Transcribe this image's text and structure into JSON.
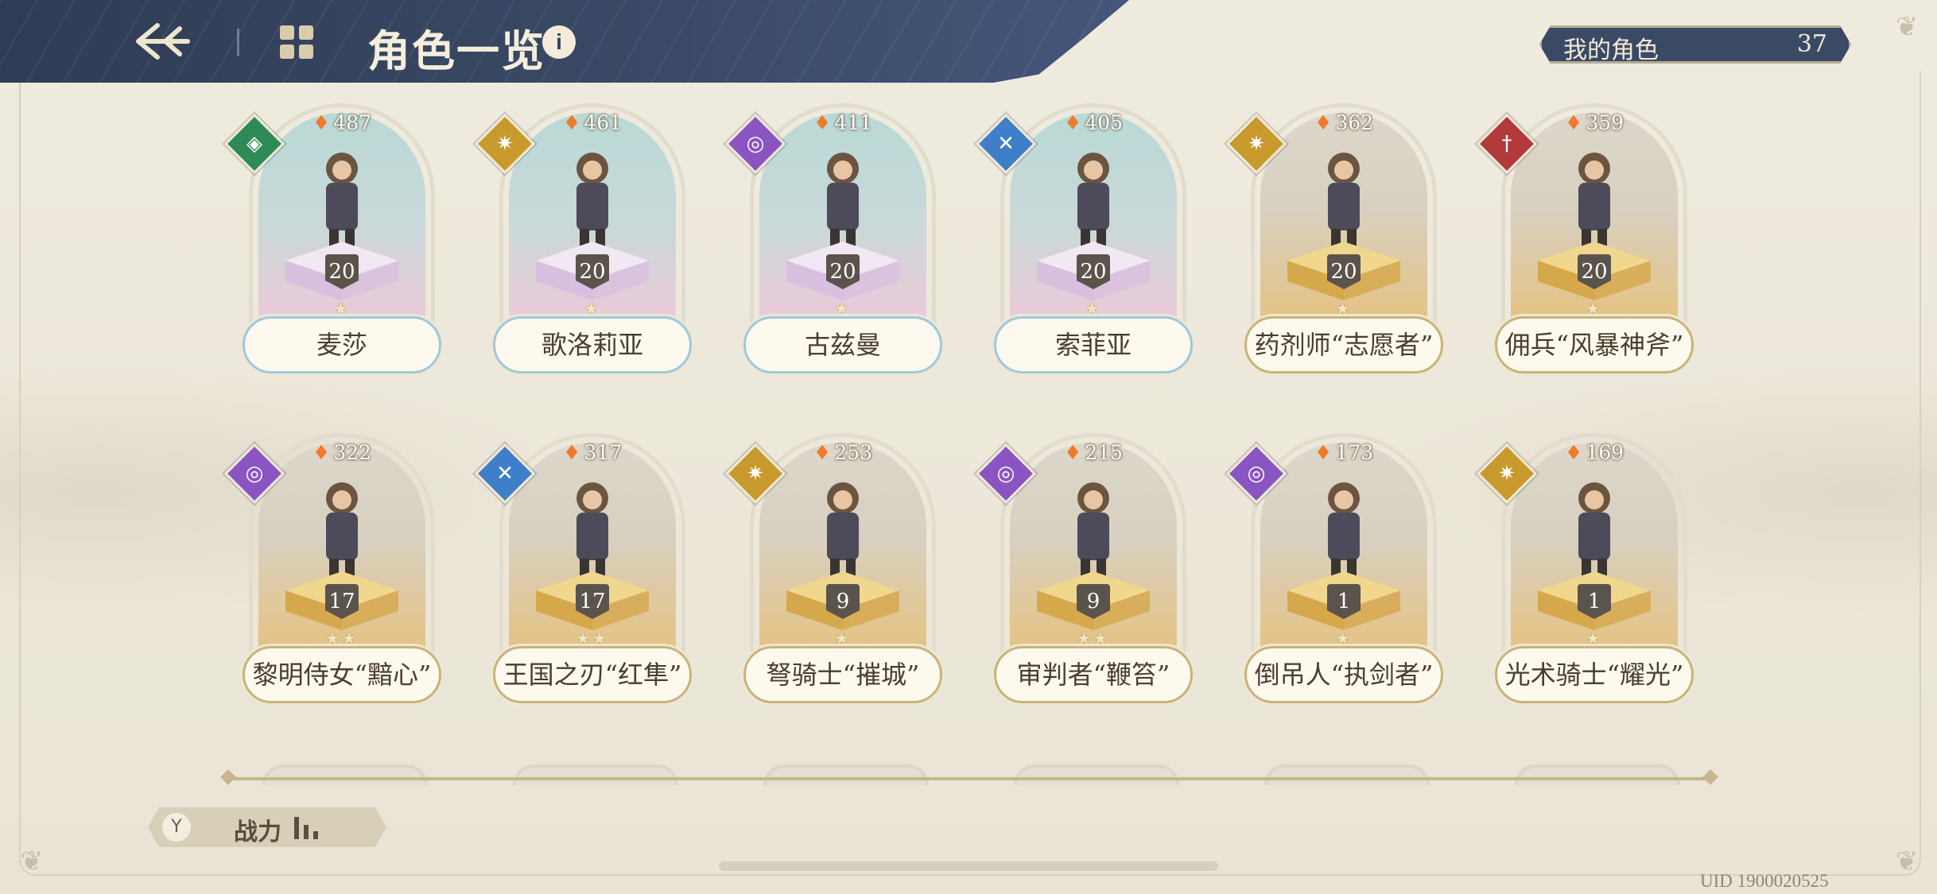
{
  "header": {
    "title": "角色一览",
    "back_icon": "back-arrow-icon",
    "grid_icon": "grid-icon",
    "info_icon": "i"
  },
  "my_roles": {
    "label": "我的角色",
    "count": "37"
  },
  "characters": [
    {
      "name": "麦莎",
      "power": "487",
      "level": "20",
      "stars": "★",
      "element": "green",
      "frame": "blue"
    },
    {
      "name": "歌洛莉亚",
      "power": "461",
      "level": "20",
      "stars": "★",
      "element": "gold",
      "frame": "blue"
    },
    {
      "name": "古兹曼",
      "power": "411",
      "level": "20",
      "stars": "★",
      "element": "purple",
      "frame": "blue"
    },
    {
      "name": "索菲亚",
      "power": "405",
      "level": "20",
      "stars": "★",
      "element": "blue",
      "frame": "blue"
    },
    {
      "name": "药剂师“志愿者”",
      "power": "362",
      "level": "20",
      "stars": "★",
      "element": "gold",
      "frame": "gold"
    },
    {
      "name": "佣兵“风暴神斧”",
      "power": "359",
      "level": "20",
      "stars": "★",
      "element": "red",
      "frame": "gold"
    },
    {
      "name": "黎明侍女“黯心”",
      "power": "322",
      "level": "17",
      "stars": "★★",
      "element": "purple",
      "frame": "gold"
    },
    {
      "name": "王国之刃“红隼”",
      "power": "317",
      "level": "17",
      "stars": "★★",
      "element": "blue",
      "frame": "gold"
    },
    {
      "name": "弩骑士“摧城”",
      "power": "253",
      "level": "9",
      "stars": "★",
      "element": "gold",
      "frame": "gold"
    },
    {
      "name": "审判者“鞭笞”",
      "power": "215",
      "level": "9",
      "stars": "★★",
      "element": "purple",
      "frame": "gold"
    },
    {
      "name": "倒吊人“执剑者”",
      "power": "173",
      "level": "1",
      "stars": "★",
      "element": "purple",
      "frame": "gold"
    },
    {
      "name": "光术骑士“耀光”",
      "power": "169",
      "level": "1",
      "stars": "★",
      "element": "gold",
      "frame": "gold"
    }
  ],
  "sort": {
    "label": "战力",
    "icon": "filter-icon"
  },
  "uid": "UID 1900020525"
}
